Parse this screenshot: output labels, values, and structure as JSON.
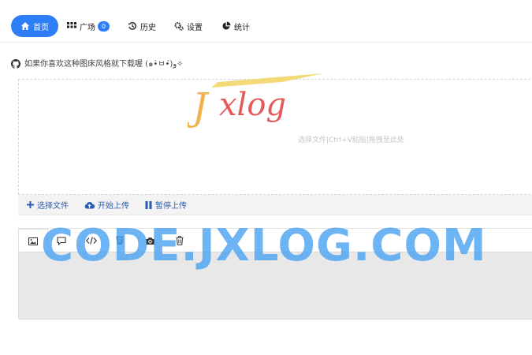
{
  "nav": {
    "items": [
      {
        "label": "首页",
        "icon": "home-icon"
      },
      {
        "label": "广场",
        "icon": "grid-icon",
        "badge": "0"
      },
      {
        "label": "历史",
        "icon": "history-icon"
      },
      {
        "label": "设置",
        "icon": "gears-icon"
      },
      {
        "label": "统计",
        "icon": "pie-chart-icon"
      }
    ],
    "active": 0
  },
  "github_line": "如果你喜欢这种图床风格就下载喔 (๑•̀ㅂ•́)و✧",
  "logo_text": "Jxlog",
  "upload": {
    "hint": "选择文件|Ctrl+V粘贴|拖拽至此处",
    "buttons": [
      {
        "label": "选择文件",
        "icon": "plus-icon"
      },
      {
        "label": "开始上传",
        "icon": "cloud-upload-icon"
      },
      {
        "label": "暂停上传",
        "icon": "pause-icon"
      }
    ]
  },
  "tabs": [
    "image-icon",
    "comment-icon",
    "code-icon",
    "html5-icon",
    "camera-icon",
    "trash-icon"
  ],
  "watermark": "CODE.JXLOG.COM",
  "colors": {
    "accent": "#2d7ef7",
    "link": "#2a5db0",
    "watermark": "#4ea4f3"
  }
}
